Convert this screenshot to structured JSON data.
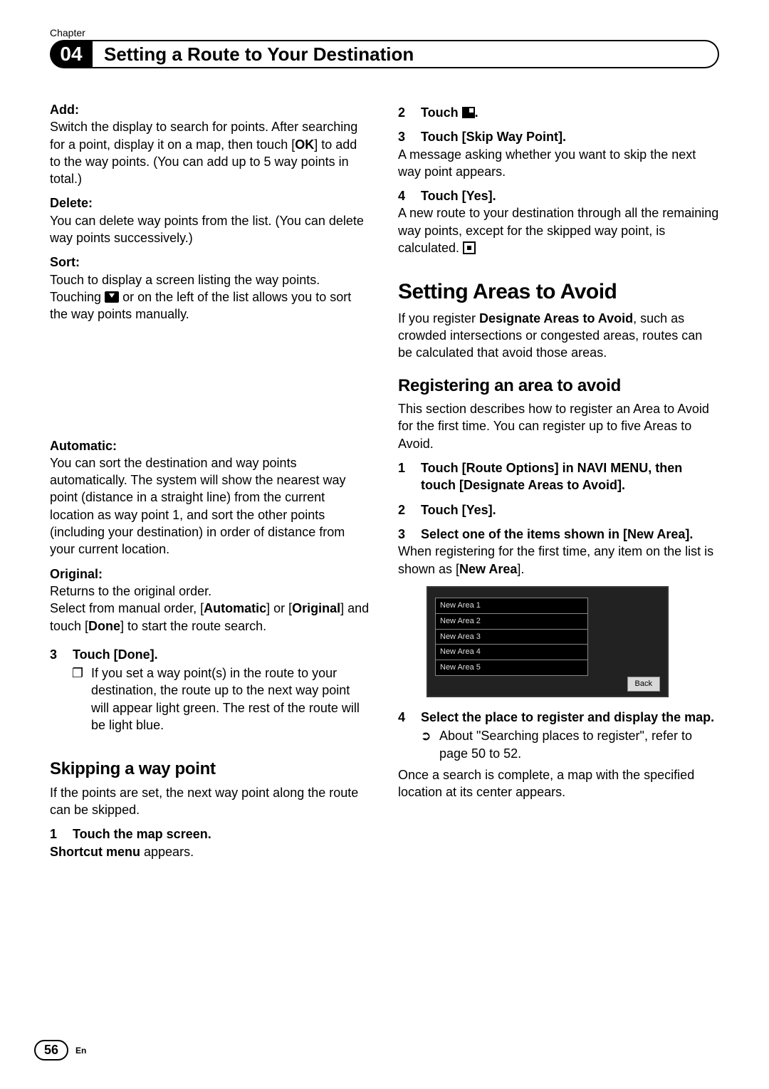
{
  "chapter_label": "Chapter",
  "chapter_number": "04",
  "chapter_title": "Setting a Route to Your Destination",
  "left": {
    "add_label": "Add",
    "add_text_1": "Switch the display to search for points. After searching for a point, display it on a map, then touch [",
    "add_ok": "OK",
    "add_text_2": "] to add to the way points. (You can add up to 5 way points in total.)",
    "delete_label": "Delete",
    "delete_text": "You can delete way points from the list. (You can delete way points successively.)",
    "sort_label": "Sort",
    "sort_text_1": "Touch to display a screen listing the way points. Touching ",
    "sort_text_2": " or       on the left of the list allows you to sort the way points manually.",
    "auto_label": "Automatic",
    "auto_text": "You can sort the destination and way points automatically. The system will show the nearest way point (distance in a straight line) from the current location as way point 1, and sort the other points (including your destination) in order of distance from your current location.",
    "orig_label": "Original",
    "orig_text_1": "Returns to the original order.",
    "orig_text_2a": "Select from manual order, [",
    "orig_auto": "Automatic",
    "orig_text_2b": "] or [",
    "orig_orig": "Original",
    "orig_text_2c": "] and touch [",
    "orig_done": "Done",
    "orig_text_2d": "] to start the route search.",
    "step3_n": "3",
    "step3_t": "Touch [Done].",
    "step3_note": "If you set a way point(s) in the route to your destination, the route up to the next way point will appear light green. The rest of the route will be light blue.",
    "skip_h": "Skipping a way point",
    "skip_p": "If the points are set, the next way point along the route can be skipped.",
    "skip_s1_n": "1",
    "skip_s1_t": "Touch the map screen.",
    "skip_s1_sub_b": "Shortcut menu",
    "skip_s1_sub_t": " appears."
  },
  "right": {
    "s2_n": "2",
    "s2_t": "Touch ",
    "s2_dot": ".",
    "s3_n": "3",
    "s3_t": "Touch [Skip Way Point].",
    "s3_p": "A message asking whether you want to skip the next way point appears.",
    "s4_n": "4",
    "s4_t": "Touch [Yes].",
    "s4_p": "A new route to your destination through all the remaining way points, except for the skipped way point, is calculated.",
    "areas_h": "Setting Areas to Avoid",
    "areas_p1a": "If you register ",
    "areas_p1b": "Designate Areas to Avoid",
    "areas_p1c": ", such as crowded intersections or congested areas, routes can be calculated that avoid those areas.",
    "reg_h": "Registering an area to avoid",
    "reg_p": "This section describes how to register an Area to Avoid for the first time. You can register up to five Areas to Avoid.",
    "r1_n": "1",
    "r1_t": "Touch [Route Options] in NAVI MENU, then touch [Designate Areas to Avoid].",
    "r2_n": "2",
    "r2_t": "Touch [Yes].",
    "r3_n": "3",
    "r3_t": "Select one of the items shown in [New Area].",
    "r3_p1": "When registering for the first time, any item on the list is shown as [",
    "r3_newarea": "New Area",
    "r3_p2": "].",
    "list": [
      "New Area 1",
      "New Area 2",
      "New Area 3",
      "New Area 4",
      "New Area 5"
    ],
    "back": "Back",
    "r4_n": "4",
    "r4_t": "Select the place to register and display the map.",
    "r4_ref": "About \"Searching places to register\", refer to page 50 to 52.",
    "r4_p": "Once a search is complete, a map with the specified location at its center appears."
  },
  "footer": {
    "page": "56",
    "lang": "En"
  }
}
